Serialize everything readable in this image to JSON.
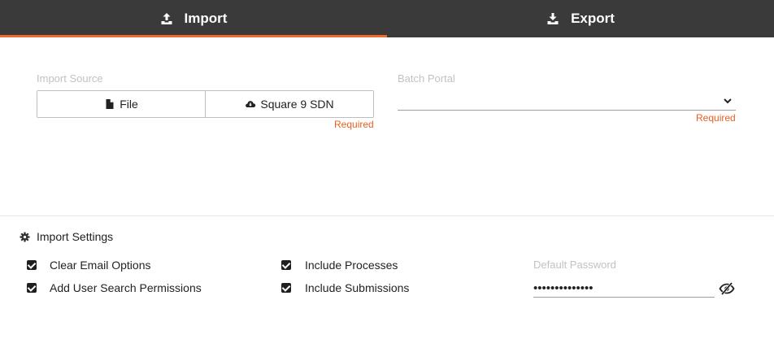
{
  "tabs": [
    {
      "label": "Import",
      "icon": "upload-icon",
      "active": true
    },
    {
      "label": "Export",
      "icon": "download-icon",
      "active": false
    }
  ],
  "import_source": {
    "label": "Import Source",
    "options": [
      {
        "label": "File",
        "icon": "file-icon"
      },
      {
        "label": "Square 9 SDN",
        "icon": "cloud-download-icon"
      }
    ],
    "required_text": "Required"
  },
  "batch_portal": {
    "label": "Batch Portal",
    "value": "",
    "required_text": "Required"
  },
  "settings": {
    "title": "Import Settings",
    "icon": "gear-icon",
    "checkboxes": [
      {
        "label": "Clear Email Options",
        "checked": true
      },
      {
        "label": "Add User Search Permissions",
        "checked": true
      },
      {
        "label": "Include Processes",
        "checked": true
      },
      {
        "label": "Include Submissions",
        "checked": true
      }
    ],
    "password": {
      "label": "Default Password",
      "value": "••••••••••••••"
    }
  },
  "colors": {
    "accent": "#ef6a2e",
    "required": "#e8601f",
    "tabbar": "#3a3a3a"
  }
}
